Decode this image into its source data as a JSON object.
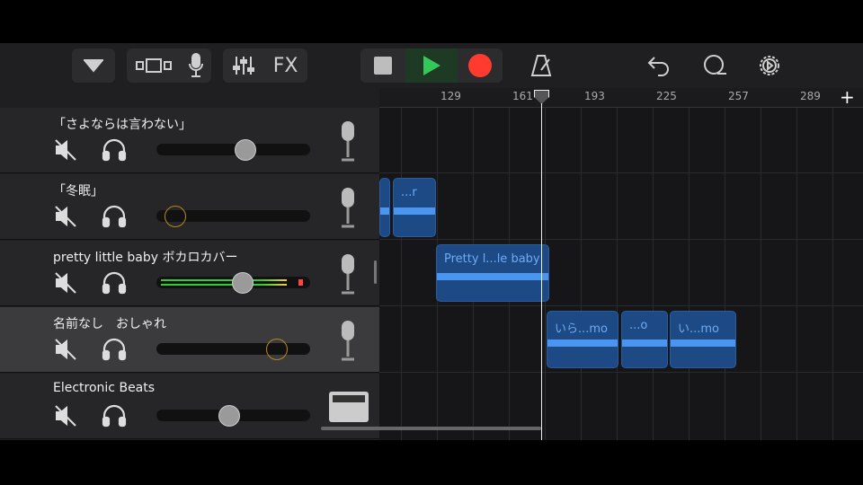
{
  "toolbar": {
    "fx_label": "FX",
    "accent_play": "#34c759",
    "accent_record": "#ff3b30"
  },
  "ruler": {
    "bars": [
      "129",
      "161",
      "193",
      "225",
      "257",
      "289"
    ],
    "add_label": "+"
  },
  "tracks": [
    {
      "name": "「さよならは言わない」",
      "volume": 0.59
    },
    {
      "name": "「冬眠」",
      "volume": 0.06
    },
    {
      "name": "pretty little baby ボカロカバー",
      "volume": 0.57
    },
    {
      "name": "名前なし　おしゃれ",
      "volume": 0.83
    },
    {
      "name": "Electronic Beats",
      "volume": 0.47
    }
  ],
  "regions": {
    "r1": "...r",
    "r2": "Pretty l...le baby",
    "r3": "いら...mo",
    "r4": "...o",
    "r5": "い...mo"
  }
}
